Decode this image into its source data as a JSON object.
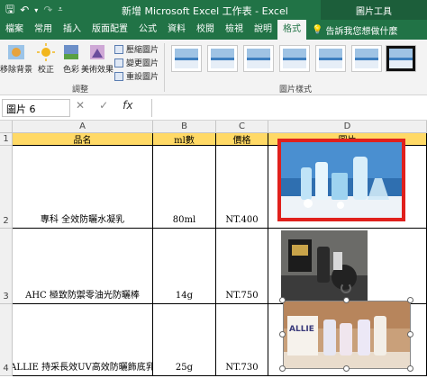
{
  "window": {
    "title": "新增 Microsoft Excel 工作表 - Excel",
    "context_tools": "圖片工具"
  },
  "ribbon_tabs": [
    "檔案",
    "常用",
    "插入",
    "版面配置",
    "公式",
    "資料",
    "校閱",
    "檢視",
    "說明",
    "格式"
  ],
  "active_tab": "格式",
  "tell_me": "告訴我您想做什麼",
  "ribbon": {
    "remove_bg": "移除背景",
    "corrections": "校正",
    "color": "色彩",
    "artistic": "美術效果",
    "compress": "壓縮圖片",
    "change_pic": "變更圖片",
    "reset_pic": "重設圖片",
    "group_adjust": "調整",
    "group_styles": "圖片樣式"
  },
  "name_box": "圖片 6",
  "formula_icons": {
    "cancel": "✕",
    "enter": "✓",
    "fx": "fx"
  },
  "columns": [
    "A",
    "B",
    "C",
    "D"
  ],
  "rows": [
    "1",
    "2",
    "3",
    "4"
  ],
  "table": {
    "headers": [
      "品名",
      "ml數",
      "價格",
      "圖片"
    ],
    "rows": [
      [
        "專科 全效防曬水凝乳",
        "80ml",
        "NT.400"
      ],
      [
        "AHC 極致防禦零油光防曬棒",
        "14g",
        "NT.750"
      ],
      [
        "ALLIE 持采長效UV高效防曬飾底乳",
        "25g",
        "NT.730"
      ]
    ]
  },
  "product_label": "ALLIE",
  "colors": {
    "excel_green": "#217346",
    "header_fill": "#ffd966",
    "selection_red": "#e0201c"
  }
}
